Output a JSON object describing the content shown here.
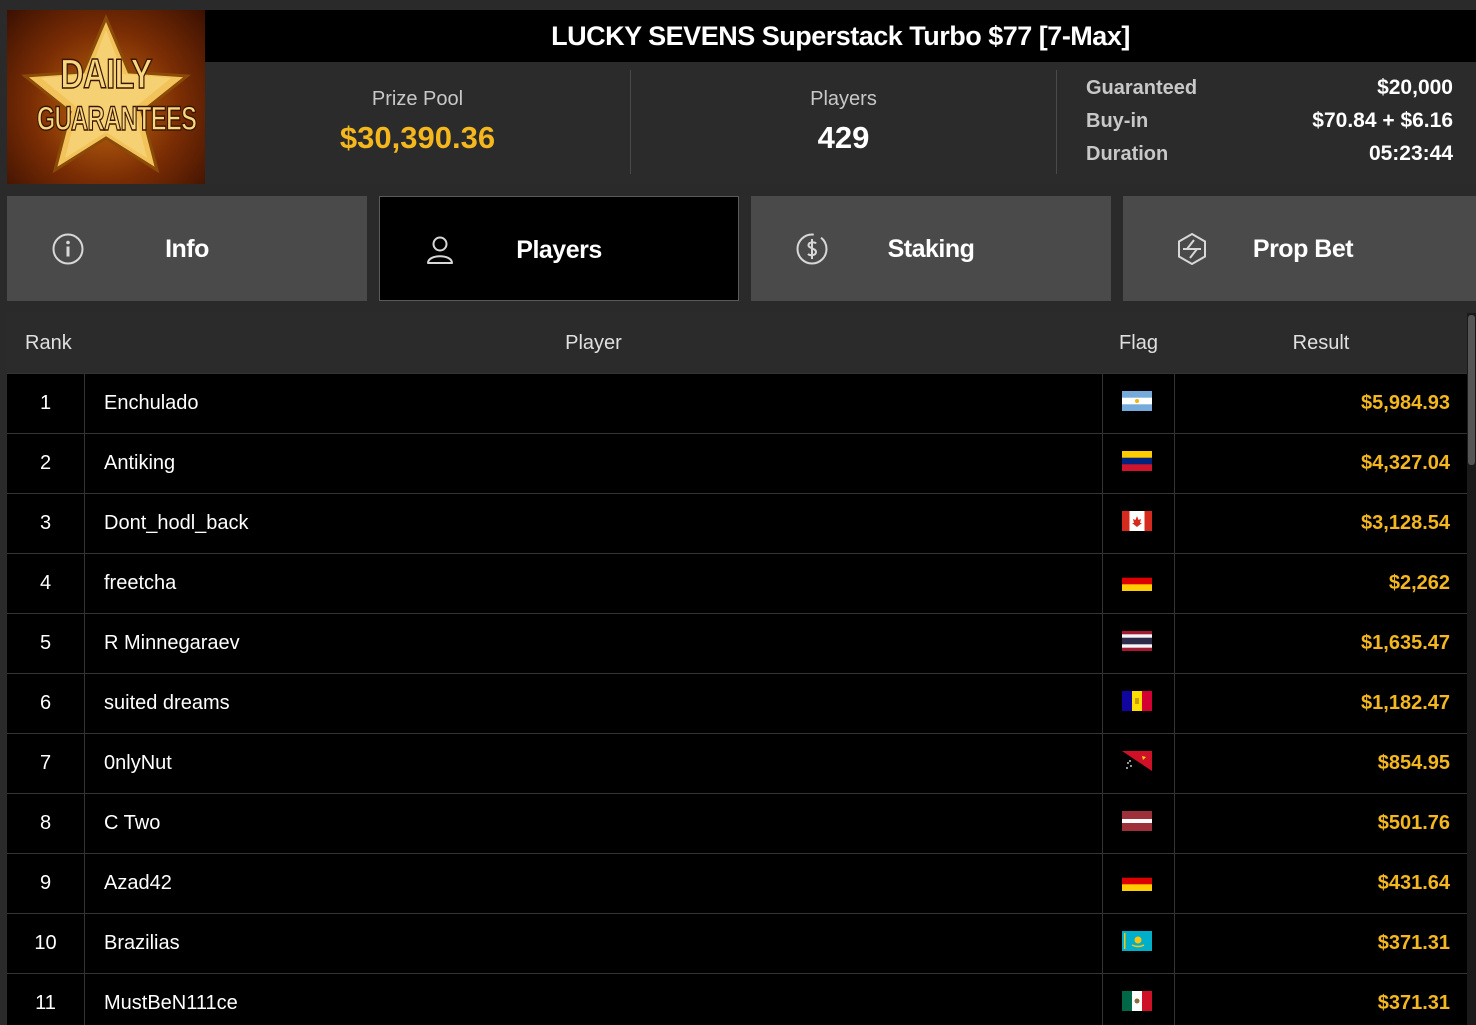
{
  "logo": {
    "line1": "DAILY",
    "line2": "GUARANTEES"
  },
  "tournament": {
    "title": "LUCKY SEVENS Superstack Turbo $77 [7-Max]",
    "prize_pool_label": "Prize Pool",
    "prize_pool": "$30,390.36",
    "players_label": "Players",
    "players": "429",
    "details": [
      {
        "label": "Guaranteed",
        "value": "$20,000"
      },
      {
        "label": "Buy-in",
        "value": "$70.84 + $6.16"
      },
      {
        "label": "Duration",
        "value": "05:23:44"
      }
    ]
  },
  "tabs": [
    {
      "label": "Info",
      "icon": "info-icon",
      "active": false
    },
    {
      "label": "Players",
      "icon": "user-icon",
      "active": true
    },
    {
      "label": "Staking",
      "icon": "dollar-coin-icon",
      "active": false
    },
    {
      "label": "Prop Bet",
      "icon": "prop-bet-icon",
      "active": false
    }
  ],
  "table": {
    "headers": {
      "rank": "Rank",
      "player": "Player",
      "flag": "Flag",
      "result": "Result"
    },
    "rows": [
      {
        "rank": "1",
        "player": "Enchulado",
        "flag": "argentina",
        "result": "$5,984.93"
      },
      {
        "rank": "2",
        "player": "Antiking",
        "flag": "venezuela",
        "result": "$4,327.04"
      },
      {
        "rank": "3",
        "player": "Dont_hodl_back",
        "flag": "canada",
        "result": "$3,128.54"
      },
      {
        "rank": "4",
        "player": "freetcha",
        "flag": "germany",
        "result": "$2,262"
      },
      {
        "rank": "5",
        "player": "R Minnegaraev",
        "flag": "thailand",
        "result": "$1,635.47"
      },
      {
        "rank": "6",
        "player": "suited dreams",
        "flag": "andorra",
        "result": "$1,182.47"
      },
      {
        "rank": "7",
        "player": "0nlyNut",
        "flag": "papua-new-guinea",
        "result": "$854.95"
      },
      {
        "rank": "8",
        "player": "C Two",
        "flag": "latvia",
        "result": "$501.76"
      },
      {
        "rank": "9",
        "player": "Azad42",
        "flag": "germany",
        "result": "$431.64"
      },
      {
        "rank": "10",
        "player": "Brazilias",
        "flag": "kazakhstan",
        "result": "$371.31"
      },
      {
        "rank": "11",
        "player": "MustBeN111ce",
        "flag": "mexico",
        "result": "$371.31"
      }
    ]
  },
  "colors": {
    "accent": "#f4b71d",
    "background": "#000000",
    "panel": "#2b2b2b",
    "tab": "#4a4a4a"
  }
}
